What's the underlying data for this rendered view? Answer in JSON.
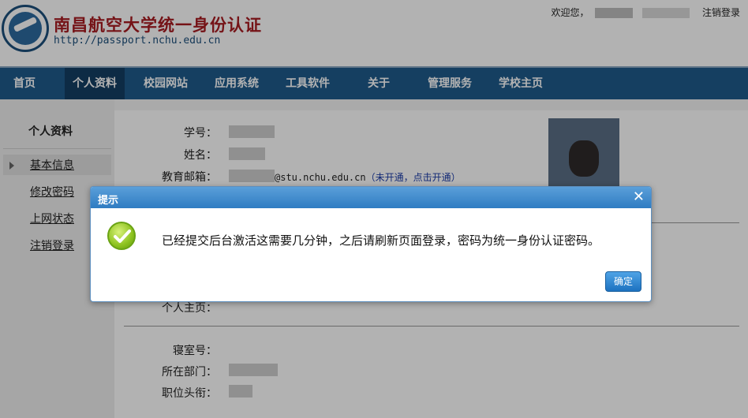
{
  "header": {
    "title_cn": "南昌航空大学统一身份认证",
    "url": "http://passport.nchu.edu.cn",
    "welcome": "欢迎您，",
    "logout_label": "注销登录"
  },
  "nav": {
    "items": [
      "首页",
      "个人资料",
      "校园网站",
      "应用系统",
      "工具软件",
      "关于",
      "管理服务",
      "学校主页"
    ],
    "active": "个人资料"
  },
  "sidebar": {
    "title": "个人资料",
    "items": [
      "基本信息",
      "修改密码",
      "上网状态",
      "注销登录"
    ],
    "active": "基本信息"
  },
  "profile": {
    "fields": {
      "student_id": "学号：",
      "name": "姓名：",
      "edu_email": "教育邮箱：",
      "homepage": "个人主页：",
      "dorm": "寝室号：",
      "department": "所在部门：",
      "title": "职位头衔："
    },
    "email_domain": "@stu.nchu.edu.cn",
    "email_status": "（未开通，点击开通）"
  },
  "dialog": {
    "title": "提示",
    "message": "已经提交后台激活这需要几分钟，之后请刷新页面登录，密码为统一身份认证密码。",
    "ok_label": "确定",
    "close_glyph": "✕"
  },
  "colors": {
    "nav_bg": "#1f5b8c",
    "nav_active": "#143e63",
    "title_red": "#a81c22",
    "dialog_header": "#2f7cc2",
    "success_green": "#8dc21f"
  }
}
